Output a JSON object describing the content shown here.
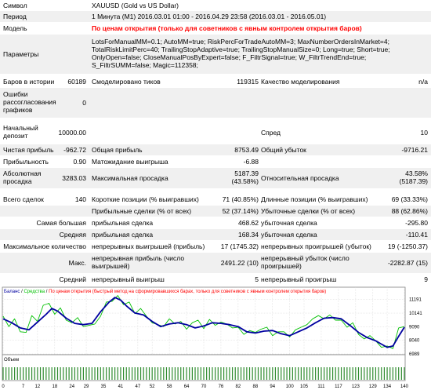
{
  "report": {
    "symbol_label": "Символ",
    "symbol_value": "XAUUSD (Gold vs US Dollar)",
    "period_label": "Период",
    "period_value": "1 Минута (M1) 2016.03.01 01:00 - 2016.04.29 23:58 (2016.03.01 - 2016.05.01)",
    "model_label": "Модель",
    "model_value": "По ценам открытия (только для советников с явным контролем открытия баров)",
    "params_label": "Параметры",
    "params_line1": "LotsForManualMM=0.1; AutoMM=true; RiskPercForTradeAutoMM=3; MaxNumberOrdersInMarket=4;",
    "params_line2": "TotalRiskLimitPerc=40; TrailingStopAdaptive=true; TrailingStopManualSize=0; Long=true; Short=true;",
    "params_line3": "OnlyOpen=false; CloseManualPosByExpert=false; F_FiltrSignal=true; W_FiltrTrendEnd=true;",
    "params_line4": "S_FiltrSUMM=false; Magic=112358;",
    "bars_label": "Баров в истории",
    "bars_value": "60189",
    "ticks_label": "Смоделировано тиков",
    "ticks_value": "119315",
    "quality_label": "Качество моделирования",
    "quality_value": "n/a",
    "errors_label": "Ошибки рассогласования графиков",
    "errors_value": "0",
    "deposit_label": "Начальный депозит",
    "deposit_value": "10000.00",
    "spread_label": "Спред",
    "spread_value": "10",
    "net_profit_label": "Чистая прибыль",
    "net_profit_value": "-962.72",
    "gross_profit_label": "Общая прибыль",
    "gross_profit_value": "8753.49",
    "gross_loss_label": "Общий убыток",
    "gross_loss_value": "-9716.21",
    "profit_factor_label": "Прибыльность",
    "profit_factor_value": "0.90",
    "expected_payoff_label": "Матожидание выигрыша",
    "expected_payoff_value": "-6.88",
    "abs_dd_label": "Абсолютная просадка",
    "abs_dd_value": "3283.03",
    "max_dd_label": "Максимальная просадка",
    "max_dd_value1": "5187.39",
    "max_dd_value2": "(43.58%)",
    "rel_dd_label": "Относительная просадка",
    "rel_dd_value1": "43.58%",
    "rel_dd_value2": "(5187.39)",
    "total_trades_label": "Всего сделок",
    "total_trades_value": "140",
    "short_label": "Короткие позиции (% выигравших)",
    "short_value": "71 (40.85%)",
    "long_label": "Длинные позиции (% выигравших)",
    "long_value": "69 (33.33%)",
    "profit_trades_label": "Прибыльные сделки (% от всех)",
    "profit_trades_value": "52 (37.14%)",
    "loss_trades_label": "Убыточные сделки (% от всех)",
    "loss_trades_value": "88 (62.86%)",
    "largest_label": "Самая большая",
    "largest_profit_label": "прибыльная сделка",
    "largest_profit_value": "468.62",
    "largest_loss_label": "убыточная сделка",
    "largest_loss_value": "-295.80",
    "average_label": "Средняя",
    "average_profit_label": "прибыльная сделка",
    "average_profit_value": "168.34",
    "average_loss_label": "убыточная сделка",
    "average_loss_value": "-110.41",
    "max_count_label": "Максимальное количество",
    "max_cons_wins_label": "непрерывных выигрышей (прибыль)",
    "max_cons_wins_value": "17 (1745.32)",
    "max_cons_losses_label": "непрерывных проигрышей (убыток)",
    "max_cons_losses_value": "19 (-1250.37)",
    "max_label": "Макс.",
    "max_cons_profit_label": "непрерывная прибыль (число выигрышей)",
    "max_cons_profit_value": "2491.22 (10)",
    "max_cons_loss_label": "непрерывный убыток (число проигрышей)",
    "max_cons_loss_value": "-2282.87 (15)",
    "avg_label": "Средний",
    "avg_cons_wins_label": "непрерывный выигрыш",
    "avg_cons_wins_value": "5",
    "avg_cons_losses_label": "непрерывный проигрыш",
    "avg_cons_losses_value": "9"
  },
  "chart_header": {
    "balance": "Баланс",
    "separator1": " / ",
    "equity": "Средства",
    "separator2": " / ",
    "mode_note": "По ценам открытия (быстрый метод на сформировавшихся барах, только для советников с явным контролем открытия баров)"
  },
  "volume_label": "Объем",
  "colors": {
    "balance": "#0000a0",
    "equity": "#00c000",
    "note": "#ff0000",
    "volume": "#2e8b2e"
  },
  "chart_data": {
    "type": "line",
    "x_ticks": [
      "0",
      "7",
      "12",
      "18",
      "24",
      "29",
      "35",
      "41",
      "47",
      "52",
      "58",
      "64",
      "70",
      "76",
      "82",
      "88",
      "94",
      "100",
      "105",
      "111",
      "117",
      "123",
      "129",
      "134",
      "140"
    ],
    "y_ticks": [
      11191,
      10141,
      9090,
      8040,
      6989
    ],
    "xlim": [
      0,
      140
    ],
    "ylim": [
      6989,
      11600
    ],
    "series": [
      {
        "name": "Баланс",
        "x": [
          0,
          3,
          6,
          9,
          12,
          15,
          17,
          19,
          22,
          25,
          28,
          31,
          34,
          37,
          39,
          41,
          43,
          46,
          49,
          52,
          55,
          58,
          61,
          64,
          67,
          70,
          73,
          76,
          79,
          82,
          85,
          88,
          91,
          94,
          97,
          100,
          103,
          106,
          109,
          112,
          115,
          118,
          121,
          124,
          127,
          130,
          132,
          134,
          136,
          138,
          140
        ],
        "y": [
          9700,
          9400,
          9000,
          8850,
          9450,
          10050,
          10500,
          10300,
          9750,
          9350,
          9250,
          9350,
          10250,
          11000,
          11350,
          11150,
          10700,
          10150,
          10000,
          9500,
          9100,
          9300,
          9400,
          9250,
          9000,
          9150,
          9400,
          9350,
          9250,
          9100,
          8700,
          8600,
          8750,
          8800,
          8550,
          8400,
          8700,
          9000,
          9400,
          9750,
          9800,
          9700,
          9200,
          8650,
          8250,
          8000,
          7750,
          7500,
          7600,
          8350,
          9050
        ]
      },
      {
        "name": "Средства",
        "x": [
          0,
          2,
          4,
          6,
          8,
          10,
          12,
          14,
          16,
          18,
          20,
          22,
          24,
          26,
          28,
          30,
          32,
          34,
          36,
          38,
          40,
          42,
          44,
          46,
          48,
          50,
          52,
          54,
          56,
          58,
          60,
          62,
          64,
          66,
          68,
          70,
          72,
          74,
          76,
          78,
          80,
          82,
          84,
          86,
          88,
          90,
          92,
          94,
          96,
          98,
          100,
          102,
          104,
          106,
          108,
          110,
          112,
          114,
          116,
          118,
          120,
          122,
          124,
          126,
          128,
          130,
          132,
          134,
          136,
          138,
          140
        ],
        "y": [
          9900,
          9100,
          9700,
          8700,
          8650,
          9950,
          9500,
          10750,
          10900,
          10050,
          10550,
          9600,
          9400,
          9800,
          9100,
          9200,
          9300,
          9900,
          11000,
          11050,
          11500,
          10800,
          11000,
          10100,
          10500,
          9900,
          9400,
          9250,
          9100,
          9700,
          9300,
          9500,
          8900,
          9400,
          9600,
          8950,
          9650,
          9200,
          9450,
          9300,
          9000,
          9050,
          8500,
          8800,
          8650,
          8900,
          9050,
          8400,
          8700,
          8700,
          8300,
          8850,
          9050,
          9250,
          9700,
          9950,
          9700,
          10000,
          9600,
          9600,
          9050,
          9400,
          8500,
          8150,
          8400,
          8000,
          7500,
          7600,
          7400,
          9000,
          9100
        ]
      }
    ],
    "volume": {
      "label": "Объем"
    }
  }
}
